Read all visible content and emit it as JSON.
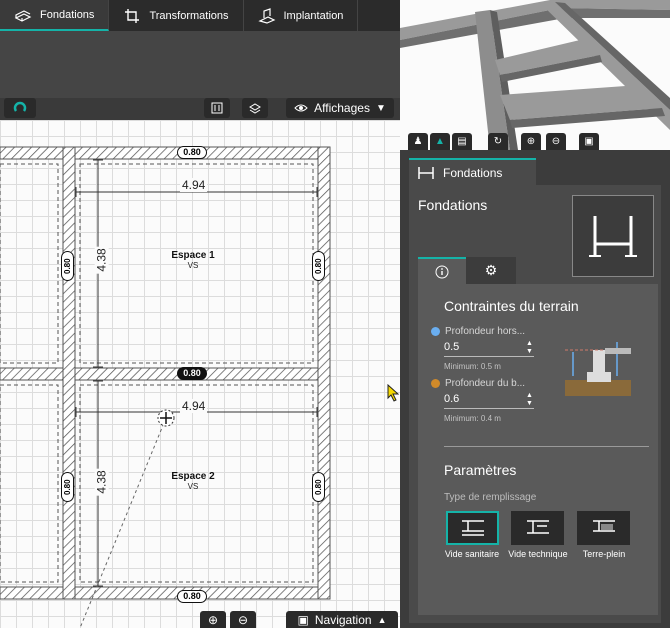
{
  "top_tabs": [
    {
      "label": "Fondations",
      "icon": "foundation-icon",
      "active": true
    },
    {
      "label": "Transformations",
      "icon": "transform-icon",
      "active": false
    },
    {
      "label": "Implantation",
      "icon": "implantation-icon",
      "active": false
    }
  ],
  "view_bar": {
    "affichages_label": "Affichages"
  },
  "plan": {
    "wall_thickness_labels": [
      "0.80",
      "0.80",
      "0.80",
      "0.80",
      "0.80",
      "0.80",
      "0.80",
      "0.80"
    ],
    "room1": {
      "name": "Espace 1",
      "sub": "VS",
      "width": "4.94",
      "height": "4.38"
    },
    "room2": {
      "name": "Espace 2",
      "sub": "VS",
      "width": "4.94",
      "height": "4.38"
    },
    "selected_wall_label": "0.80"
  },
  "navigation": {
    "label": "Navigation"
  },
  "panel": {
    "tab_label": "Fondations",
    "title": "Fondations",
    "section1_title": "Contraintes du terrain",
    "field1": {
      "label": "Profondeur hors...",
      "value": "0.5",
      "min": "Minimum: 0.5 m",
      "color": "#6aaef0"
    },
    "field2": {
      "label": "Profondeur du b...",
      "value": "0.6",
      "min": "Minimum: 0.4 m",
      "color": "#d08a2a"
    },
    "section2_title": "Paramètres",
    "fill_type_label": "Type de remplissage",
    "fill_options": [
      {
        "label": "Vide sanitaire",
        "selected": true
      },
      {
        "label": "Vide technique",
        "selected": false
      },
      {
        "label": "Terre-plein",
        "selected": false
      }
    ]
  },
  "accent_color": "#15b3a8"
}
